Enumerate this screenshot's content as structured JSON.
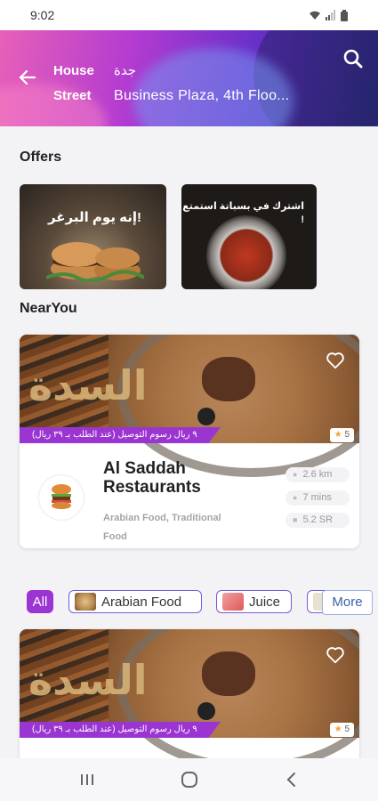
{
  "status_bar": {
    "time": "9:02"
  },
  "header": {
    "house_label": "House",
    "street_label": "Street",
    "house_value": "جدة",
    "street_value": "Business Plaza, 4th Floo..."
  },
  "offers": {
    "title": "Offers",
    "items": [
      {
        "text": "إنه يوم البرغر!"
      },
      {
        "text": "اشترك في بسباتة استمتع !"
      }
    ]
  },
  "near_you": {
    "title": "NearYou",
    "restaurant": {
      "name_line1": "Al Saddah",
      "name_line2": "Restaurants",
      "cuisine": "Arabian Food, Traditional Food",
      "distance": "2.6 km",
      "time": "7 mins",
      "delivery_fee": "5.2 SR",
      "delivery_badge": "٩ ريال رسوم التوصيل (عند الطلب بـ ٣٩ ريال)",
      "rating": "5",
      "logo_text": "السدة"
    }
  },
  "filters": {
    "chips": [
      "All",
      "Arabian Food",
      "Juice"
    ],
    "more_label": "More"
  },
  "colors": {
    "accent": "#9b35d1",
    "more_text": "#3a64a8"
  }
}
